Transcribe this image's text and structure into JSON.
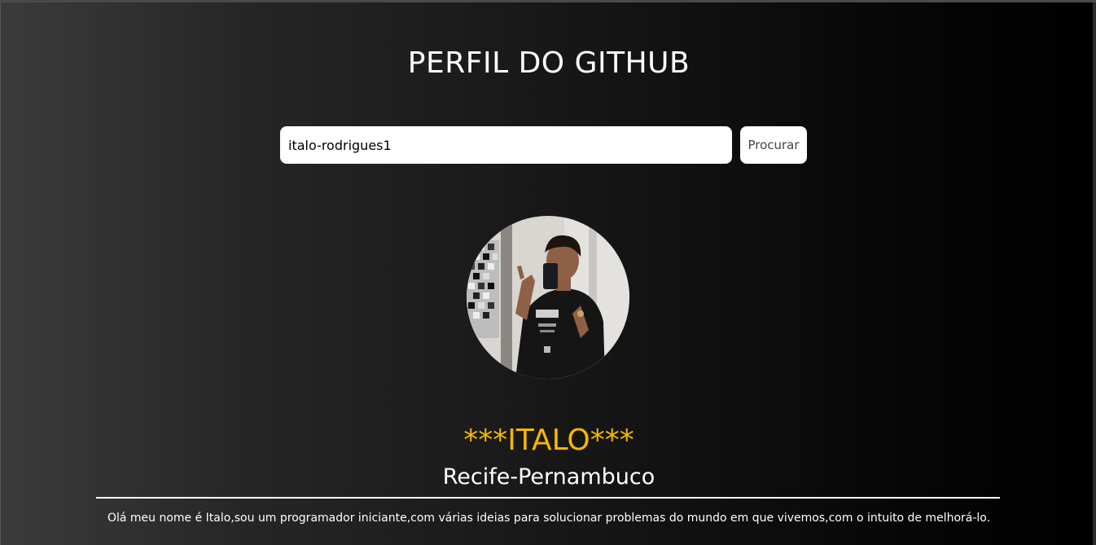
{
  "header": {
    "title": "PERFIL DO GITHUB"
  },
  "search": {
    "value": "italo-rodrigues1",
    "button_label": "Procurar"
  },
  "profile": {
    "avatar_icon": "user-avatar-photo",
    "name": "***ITALO***",
    "location": "Recife-Pernambuco",
    "bio": "Olá meu nome é Italo,sou um programador iniciante,com várias ideias para solucionar problemas do mundo em que vivemos,com o intuito de melhorá-lo."
  },
  "colors": {
    "accent_name": "#f5b700",
    "background_left": "#3b3b3b",
    "background_right": "#000000"
  }
}
